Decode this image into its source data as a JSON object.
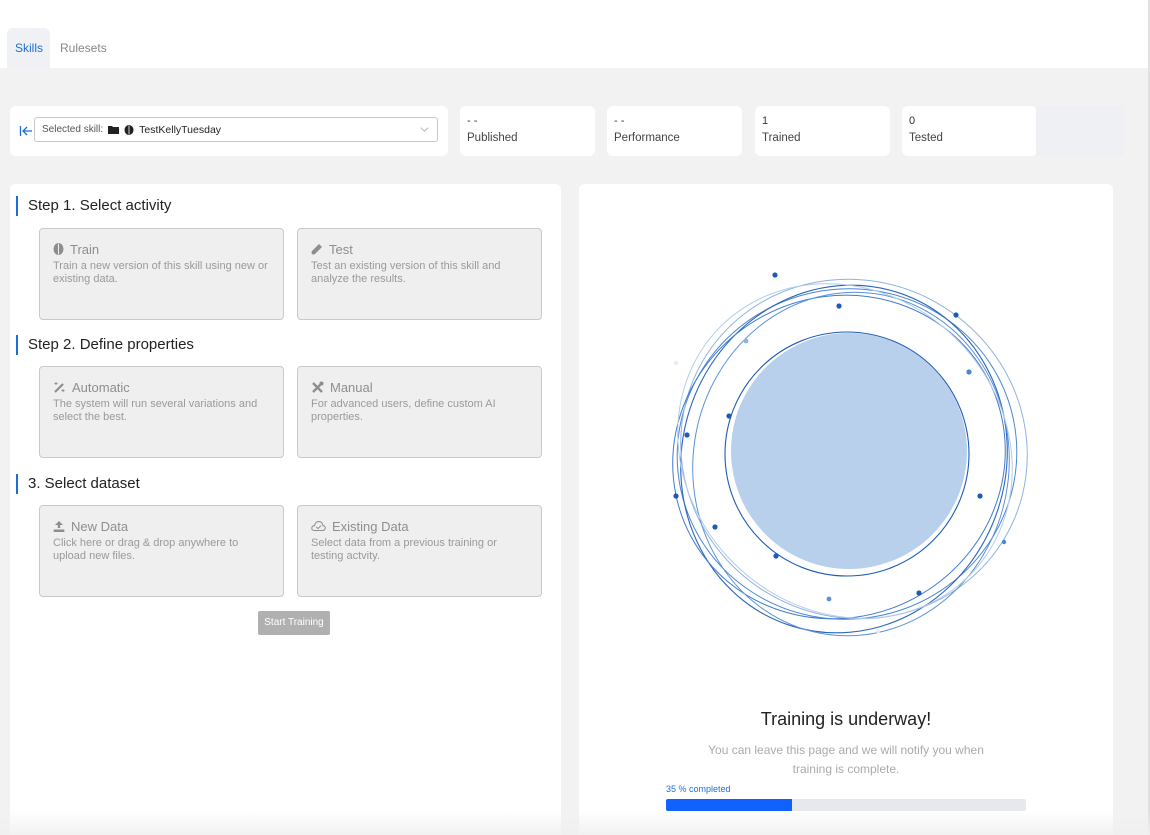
{
  "tabs": [
    {
      "label": "Skills",
      "active": true
    },
    {
      "label": "Rulesets",
      "active": false
    }
  ],
  "skill_selector": {
    "label": "Selected skill:",
    "value": "TestKellyTuesday",
    "icons": [
      "folder-icon",
      "brain-icon"
    ]
  },
  "stats": [
    {
      "value": "- -",
      "label": "Published"
    },
    {
      "value": "- -",
      "label": "Performance"
    },
    {
      "value": "1",
      "label": "Trained"
    },
    {
      "value": "0",
      "label": "Tested"
    }
  ],
  "steps": [
    {
      "title": "Step 1. Select activity",
      "options": [
        {
          "icon": "brain-icon",
          "title": "Train",
          "description": "Train a new version of this skill using new or existing data."
        },
        {
          "icon": "test-tube-icon",
          "title": "Test",
          "description": "Test an existing version of this skill and analyze the results."
        }
      ]
    },
    {
      "title": "Step 2. Define properties",
      "options": [
        {
          "icon": "magic-wand-icon",
          "title": "Automatic",
          "description": "The system will run several variations and select the best."
        },
        {
          "icon": "tools-icon",
          "title": "Manual",
          "description": "For advanced users, define custom AI properties."
        }
      ]
    },
    {
      "title": "3. Select dataset",
      "options": [
        {
          "icon": "upload-icon",
          "title": "New Data",
          "description": "Click here or drag & drop anywhere to upload new files."
        },
        {
          "icon": "cloud-check-icon",
          "title": "Existing Data",
          "description": "Select data from a previous training or testing actvity."
        }
      ]
    }
  ],
  "start_button": {
    "label": "Start Training",
    "enabled": false
  },
  "training_status": {
    "title": "Training is underway!",
    "subtitle": "You can leave this page and we will notify you when training is complete.",
    "progress_label": "35 % completed",
    "progress_percent": 35
  },
  "colors": {
    "accent": "#1a6fd9",
    "progress": "#0f62fe",
    "viz_fill": "#b8d0eb",
    "viz_stroke": "#1e5bb8"
  }
}
